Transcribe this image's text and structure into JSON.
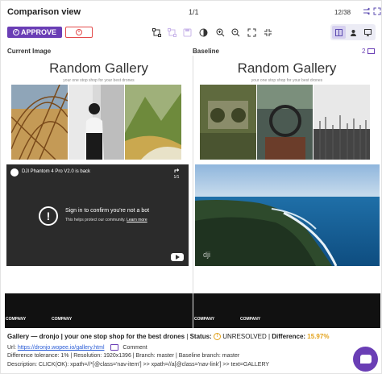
{
  "header": {
    "title": "Comparison view",
    "page_counter": "1/1",
    "item_counter": "12/38"
  },
  "toolbar": {
    "approve_label": "APPROVE",
    "view_mode_selected": "side-by-side"
  },
  "panels": {
    "left_label": "Current Image",
    "right_label": "Baseline",
    "right_count": "2"
  },
  "gallery": {
    "title": "Random Gallery",
    "subtitle": "your one stop shop for your best drones",
    "footer_label": "COMPANY"
  },
  "video": {
    "title": "DJI Phantom 4 Pro V2.0 is back",
    "share_count": "1/1",
    "message": "Sign in to confirm you're not a bot",
    "help_text": "This helps protect our community.",
    "help_link": "Learn more"
  },
  "info": {
    "name": "Gallery — dronjo | your one stop shop for the best drones",
    "status_label": "Status:",
    "status_value": "UNRESOLVED",
    "difference_label": "Difference:",
    "difference_value": "15.97%",
    "url_label": "Url:",
    "url_value": "https://dronjo.wopee.io/gallery.html",
    "comment_label": "Comment",
    "details": "Difference tolerance: 1% | Resolution: 1920x1396 | Branch: master | Baseline branch: master",
    "description": "Description: CLICK(OK): xpath=//*[@class='nav-item'] >> xpath=//a[@class='nav-link'] >> text=GALLERY"
  },
  "colors": {
    "accent": "#6a3eb5",
    "reject": "#e34a4a",
    "warning": "#e3a21a"
  }
}
